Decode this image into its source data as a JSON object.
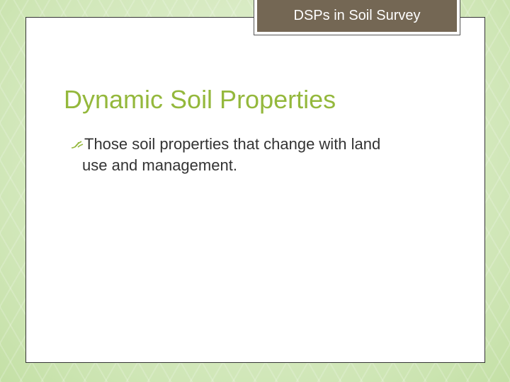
{
  "header": {
    "tag_label": "DSPs in Soil Survey"
  },
  "slide": {
    "title": "Dynamic Soil Properties",
    "bullets": [
      {
        "icon": "leaf-bullet-icon",
        "text_line1": "Those soil properties that change with land",
        "text_line2": "use and management."
      }
    ]
  },
  "colors": {
    "title": "#94b83c",
    "tag_bg": "#746754",
    "background": "#dfeecf"
  }
}
